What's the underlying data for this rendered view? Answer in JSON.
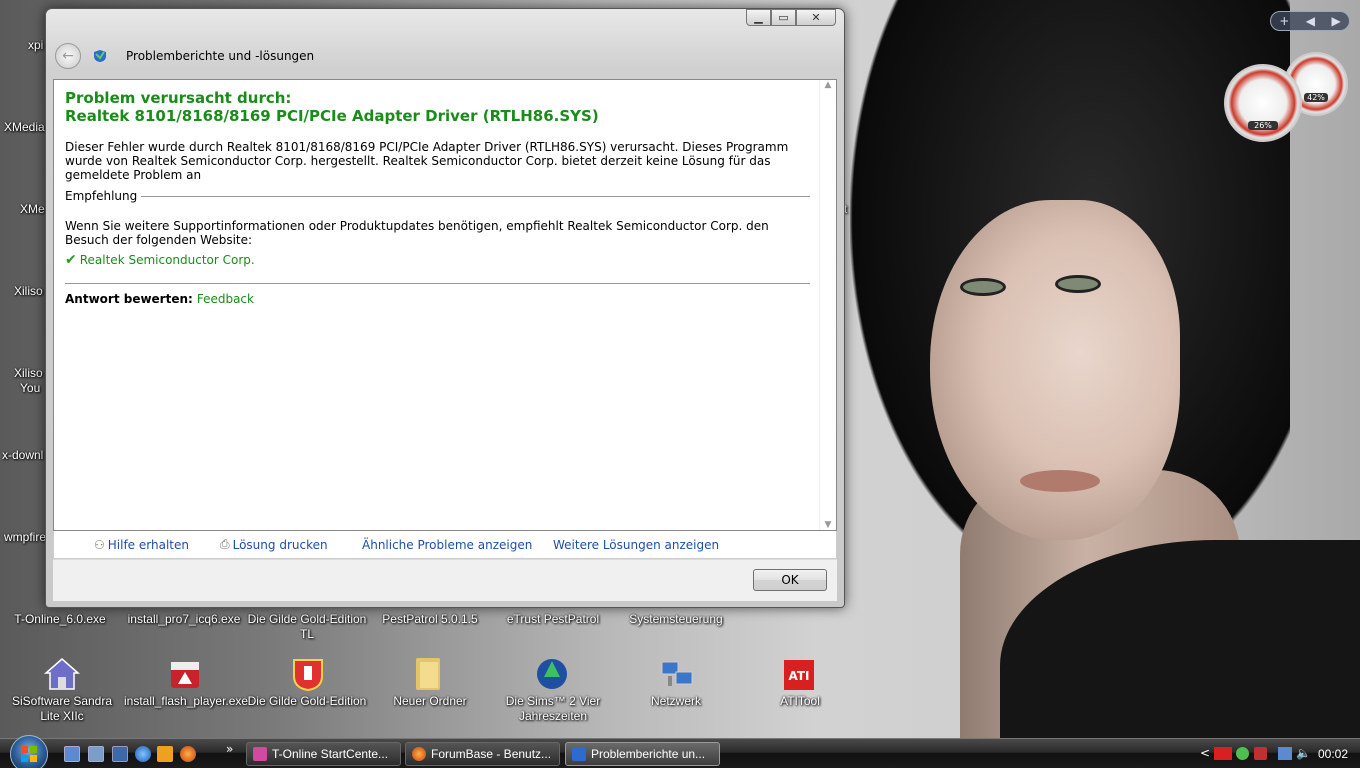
{
  "window": {
    "title": "Problemberichte und -lösungen",
    "headline_line1": "Problem verursacht durch:",
    "headline_line2": "Realtek 8101/8168/8169 PCI/PCIe Adapter Driver (RTLH86.SYS)",
    "description": "Dieser Fehler wurde durch Realtek 8101/8168/8169 PCI/PCIe Adapter Driver (RTLH86.SYS) verursacht. Dieses Programm wurde von Realtek Semiconductor Corp. hergestellt. Realtek Semiconductor Corp. bietet derzeit keine Lösung für das gemeldete Problem an",
    "recommendation_heading": "Empfehlung",
    "recommendation_text": "Wenn Sie weitere Supportinformationen oder Produktupdates benötigen, empfiehlt Realtek Semiconductor Corp. den Besuch der folgenden Website:",
    "recommendation_link": "Realtek Semiconductor Corp.",
    "rate_label": "Antwort bewerten:",
    "rate_link": "Feedback",
    "links": [
      "Hilfe erhalten",
      "Lösung drucken",
      "Ähnliche Probleme anzeigen",
      "Weitere Lösungen anzeigen"
    ],
    "ok_label": "OK"
  },
  "desktop": {
    "left_labels": [
      "xpi",
      "XMedia",
      "XMe",
      "Xiliso",
      "Xiliso",
      "You",
      "x-downl",
      "wmpfire"
    ],
    "row1": [
      "T-Online_6.0.exe",
      "install_pro7_icq6.exe",
      "Die Gilde Gold-Edition TL",
      "PestPatrol 5.0.1.5",
      "eTrust PestPatrol",
      "Systemsteuerung"
    ],
    "row2": [
      "SiSoftware Sandra Lite XIIc",
      "install_flash_player.exe",
      "Die Gilde Gold-Edition",
      "Neuer Ordner",
      "Die Sims™ 2 Vier Jahreszeiten",
      "Netzwerk",
      "ATITool"
    ],
    "right_partial": "xt"
  },
  "gadgets": {
    "controls": [
      "+",
      "◀",
      "▶"
    ],
    "cpu_percent": "26%",
    "mem_percent": "42%"
  },
  "taskbar": {
    "overflow": "»",
    "tasks": [
      "T-Online StartCente...",
      "ForumBase - Benutz...",
      "Problemberichte un..."
    ],
    "tray_arrow": "<",
    "clock": "00:02"
  }
}
